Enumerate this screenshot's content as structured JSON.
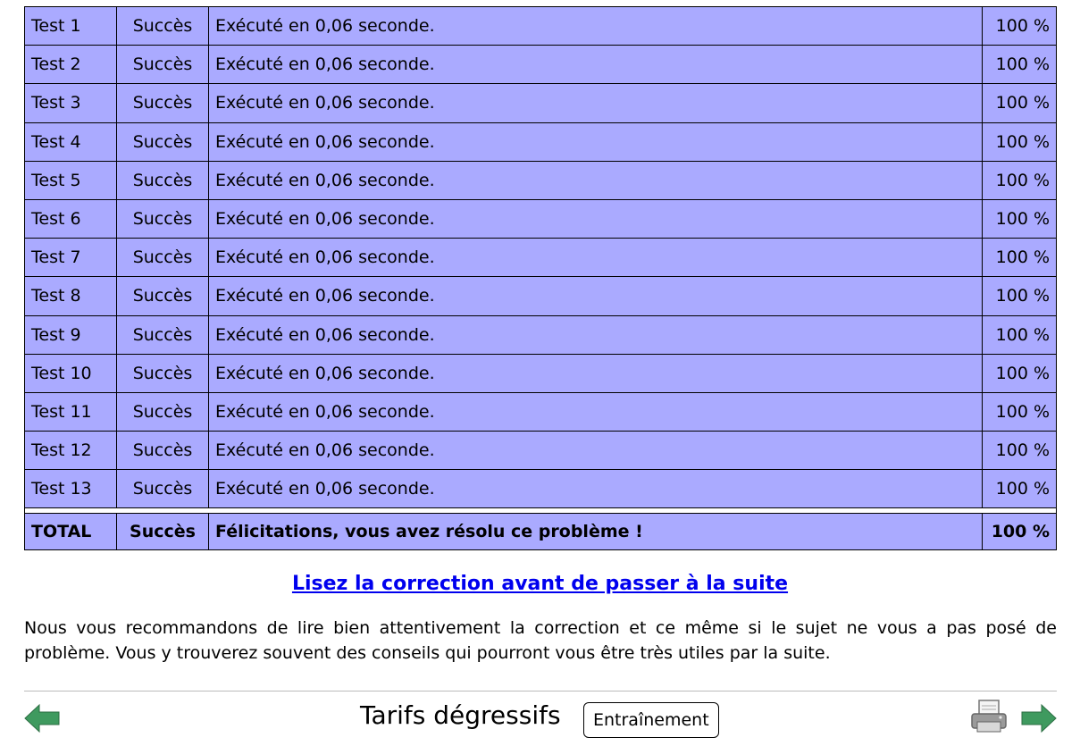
{
  "results": {
    "rows": [
      {
        "name": "Test 1",
        "status": "Succès",
        "message": "Exécuté en 0,06 seconde.",
        "score": "100 %"
      },
      {
        "name": "Test 2",
        "status": "Succès",
        "message": "Exécuté en 0,06 seconde.",
        "score": "100 %"
      },
      {
        "name": "Test 3",
        "status": "Succès",
        "message": "Exécuté en 0,06 seconde.",
        "score": "100 %"
      },
      {
        "name": "Test 4",
        "status": "Succès",
        "message": "Exécuté en 0,06 seconde.",
        "score": "100 %"
      },
      {
        "name": "Test 5",
        "status": "Succès",
        "message": "Exécuté en 0,06 seconde.",
        "score": "100 %"
      },
      {
        "name": "Test 6",
        "status": "Succès",
        "message": "Exécuté en 0,06 seconde.",
        "score": "100 %"
      },
      {
        "name": "Test 7",
        "status": "Succès",
        "message": "Exécuté en 0,06 seconde.",
        "score": "100 %"
      },
      {
        "name": "Test 8",
        "status": "Succès",
        "message": "Exécuté en 0,06 seconde.",
        "score": "100 %"
      },
      {
        "name": "Test 9",
        "status": "Succès",
        "message": "Exécuté en 0,06 seconde.",
        "score": "100 %"
      },
      {
        "name": "Test 10",
        "status": "Succès",
        "message": "Exécuté en 0,06 seconde.",
        "score": "100 %"
      },
      {
        "name": "Test 11",
        "status": "Succès",
        "message": "Exécuté en 0,06 seconde.",
        "score": "100 %"
      },
      {
        "name": "Test 12",
        "status": "Succès",
        "message": "Exécuté en 0,06 seconde.",
        "score": "100 %"
      },
      {
        "name": "Test 13",
        "status": "Succès",
        "message": "Exécuté en 0,06 seconde.",
        "score": "100 %"
      }
    ],
    "total": {
      "name": "TOTAL",
      "status": "Succès",
      "message": "Félicitations, vous avez résolu ce problème !",
      "score": "100 %"
    }
  },
  "correction_link": "Lisez la correction avant de passer à la suite",
  "advice": "Nous vous recommandons de lire bien attentivement la correction et ce même si le sujet ne vous a pas posé de problème. Vous y trouverez souvent des conseils qui pourront vous être très utiles par la suite.",
  "footer": {
    "title": "Tarifs dégressifs",
    "mode_button": "Entraînement",
    "prev_icon": "left-arrow-icon",
    "next_icon": "right-arrow-icon",
    "print_icon": "printer-icon"
  },
  "colors": {
    "row_background": "#aaaaff",
    "link": "#0000ee",
    "arrow": "#3f9a5f"
  }
}
